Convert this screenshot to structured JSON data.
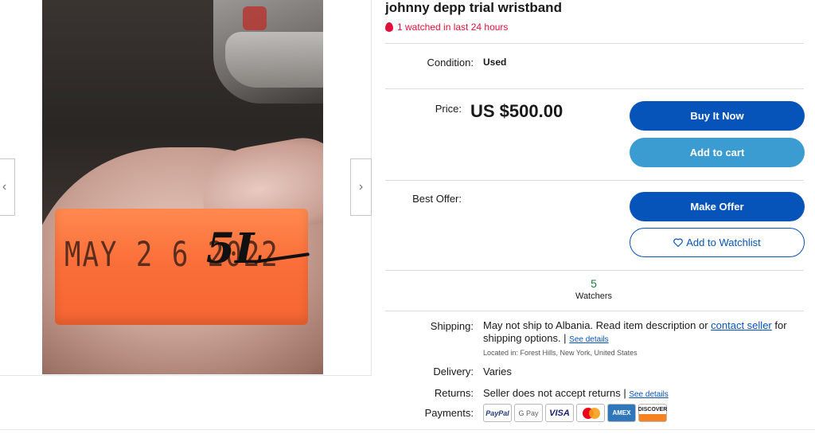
{
  "listing": {
    "title": "johnny depp trial wristband",
    "watched_notice": "1 watched in last 24 hours"
  },
  "gallery": {
    "prev_arrow": "‹",
    "next_arrow": "›",
    "photo": {
      "band_date_text": "MAY 2 6 2022",
      "band_code_text": "5L"
    }
  },
  "condition": {
    "label": "Condition:",
    "value": "Used"
  },
  "price": {
    "label": "Price:",
    "value": "US $500.00"
  },
  "buttons": {
    "buy_now": "Buy It Now",
    "add_to_cart": "Add to cart",
    "make_offer": "Make Offer",
    "add_to_watchlist": "Add to Watchlist"
  },
  "best_offer": {
    "label": "Best Offer:"
  },
  "watchers": {
    "count": "5",
    "label": "Watchers"
  },
  "shipping": {
    "label": "Shipping:",
    "text_before_link": "May not ship to Albania. Read item description or ",
    "link_text": "contact seller",
    "text_after_link": " for shipping options. | ",
    "see_details": "See details",
    "located_in": "Located in: Forest Hills, New York, United States"
  },
  "delivery": {
    "label": "Delivery:",
    "value": "Varies"
  },
  "returns": {
    "label": "Returns:",
    "value": "Seller does not accept returns | ",
    "see_details": "See details"
  },
  "payments": {
    "label": "Payments:",
    "methods": [
      "PayPal",
      "G Pay",
      "VISA",
      "Mastercard",
      "AMEX",
      "DISCOVER"
    ]
  },
  "colors": {
    "primary_blue": "#0654ba",
    "light_blue": "#3b9cd2",
    "alert_red": "#e0103a",
    "watchers_green": "#1a7f3c"
  }
}
